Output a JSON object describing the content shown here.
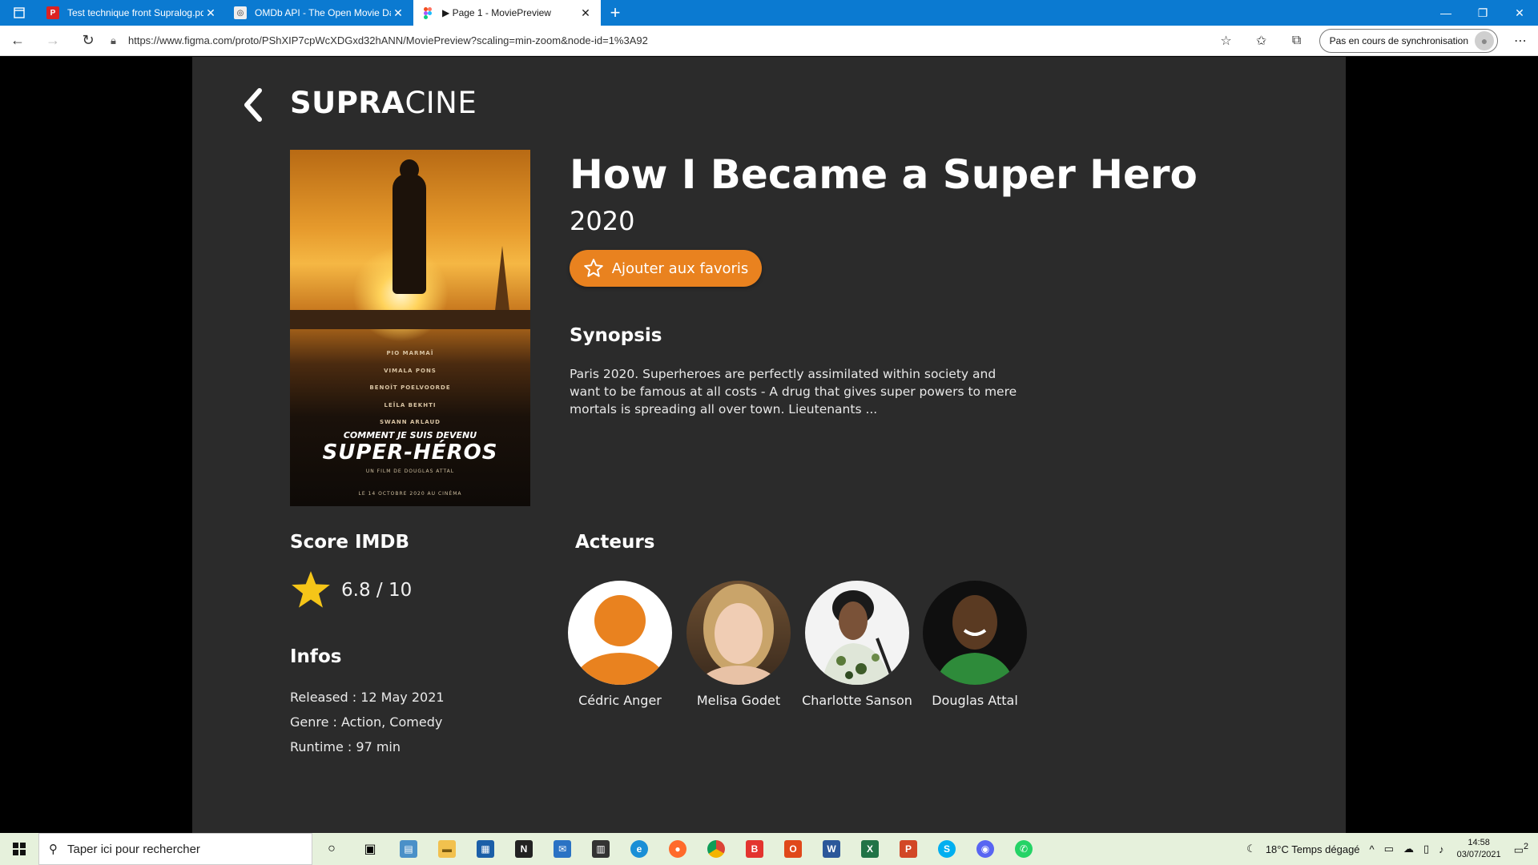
{
  "browser": {
    "tabs": [
      {
        "title": "Test technique front Supralog.pd",
        "icon": "pdf-icon",
        "active": false
      },
      {
        "title": "OMDb API - The Open Movie Da",
        "icon": "omdb-icon",
        "active": false
      },
      {
        "title": "▶ Page 1 - MoviePreview",
        "icon": "figma-icon",
        "active": true
      }
    ],
    "url": "https://www.figma.com/proto/PShXIP7cpWcXDGxd32hANN/MoviePreview?scaling=min-zoom&node-id=1%3A92",
    "sync_label": "Pas en cours de synchronisation"
  },
  "app": {
    "logo_bold": "SUPRA",
    "logo_light": "CINE"
  },
  "poster": {
    "credits": [
      "PIO MARMAÏ",
      "VIMALA PONS",
      "BENOÎT POELVOORDE",
      "LEÏLA BEKHTI",
      "SWANN ARLAUD"
    ],
    "title_top": "COMMENT JE SUIS DEVENU",
    "title_main": "SUPER-HÉROS",
    "director": "UN FILM DE DOUGLAS ATTAL",
    "date": "LE 14 OCTOBRE 2020 AU CINÉMA"
  },
  "movie": {
    "title": "How I Became a Super Hero",
    "year": "2020",
    "favorite_label": "Ajouter aux favoris",
    "synopsis_heading": "Synopsis",
    "synopsis": "Paris 2020. Superheroes are perfectly assimilated within society and want to be famous at all costs - A drug that gives super powers to mere mortals is spreading all over town. Lieutenants ...",
    "score_heading": "Score IMDB",
    "score": "6.8 / 10",
    "infos_heading": "Infos",
    "released": "Released : 12 May 2021",
    "genre": "Genre :  Action, Comedy",
    "runtime": "Runtime : 97 min",
    "actors_heading": "Acteurs",
    "actors": [
      {
        "name": "Cédric Anger",
        "placeholder": true
      },
      {
        "name": "Melisa Godet",
        "placeholder": false
      },
      {
        "name": "Charlotte Sanson",
        "placeholder": false
      },
      {
        "name": "Douglas Attal",
        "placeholder": false
      }
    ],
    "accent_color": "#e9821f",
    "star_color": "#f5c518"
  },
  "taskbar": {
    "search_placeholder": "Taper ici pour rechercher",
    "weather": "18°C  Temps dégagé",
    "time": "14:58",
    "date": "03/07/2021",
    "notification_count": "2"
  }
}
